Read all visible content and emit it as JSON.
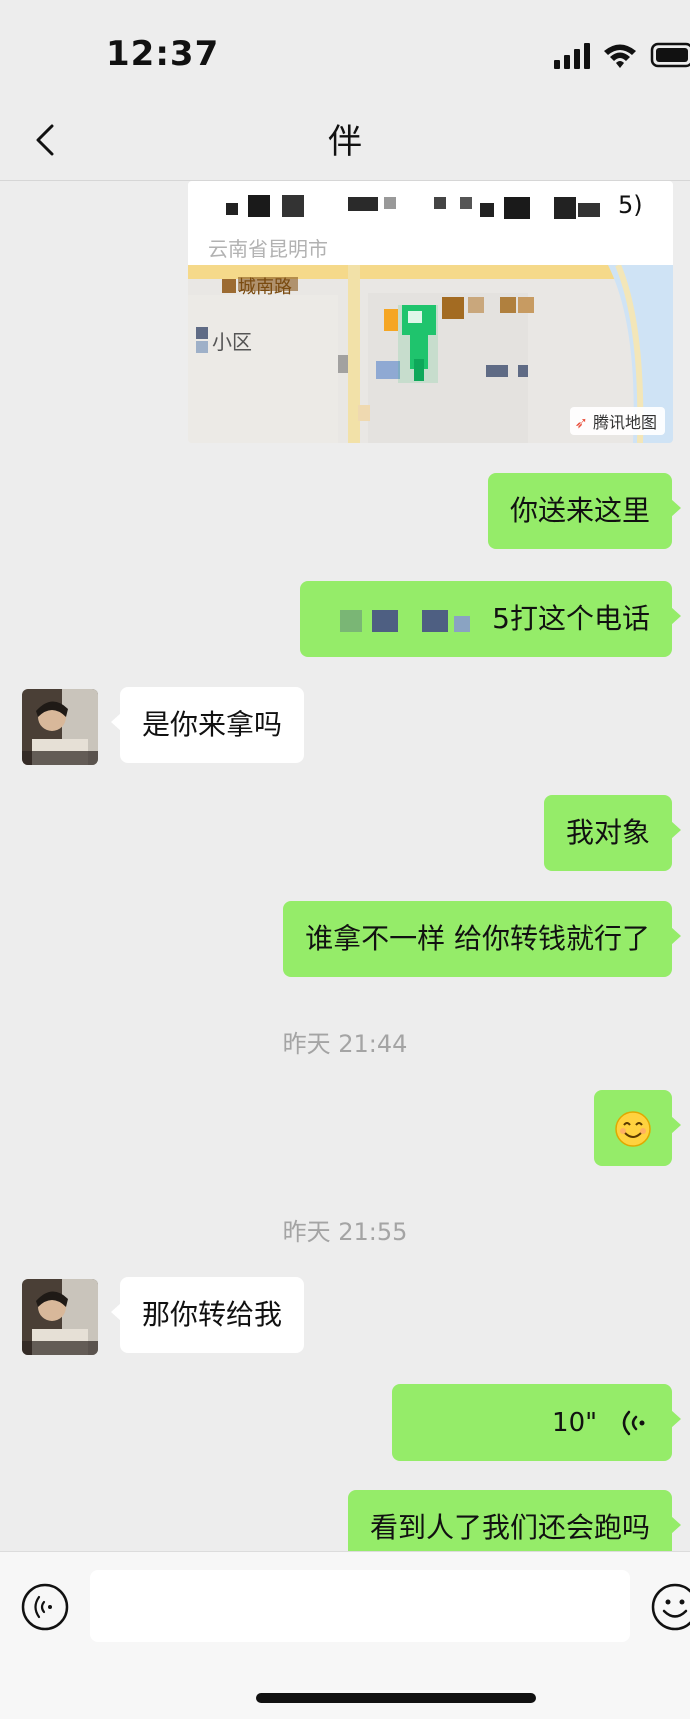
{
  "status_bar": {
    "time": "12:37"
  },
  "header": {
    "title": "伴",
    "back_icon": "chevron-left-icon"
  },
  "map": {
    "address_sub": "云南省昆明市",
    "place_label": "城南路",
    "area_label": "小区",
    "attribution": "腾讯地图",
    "snippet_suffix": "5)"
  },
  "messages": [
    {
      "side": "me",
      "text": "你送来这里"
    },
    {
      "side": "me",
      "text": "5打这个电话"
    },
    {
      "side": "other",
      "text": "是你来拿吗"
    },
    {
      "side": "me",
      "text": "我对象"
    },
    {
      "side": "me",
      "text": "谁拿不一样 给你转钱就行了"
    },
    {
      "type": "time",
      "text": "昨天 21:44"
    },
    {
      "side": "me",
      "text": "😊"
    },
    {
      "type": "time",
      "text": "昨天 21:55"
    },
    {
      "side": "other",
      "text": "那你转给我"
    },
    {
      "side": "me",
      "type": "voice",
      "text": "10\""
    },
    {
      "side": "me",
      "text": "看到人了我们还会跑吗"
    }
  ],
  "input_bar": {
    "placeholder": ""
  },
  "colors": {
    "my_bubble": "#95ec69",
    "background": "#ededed",
    "map_marker": "#1fc46d"
  }
}
